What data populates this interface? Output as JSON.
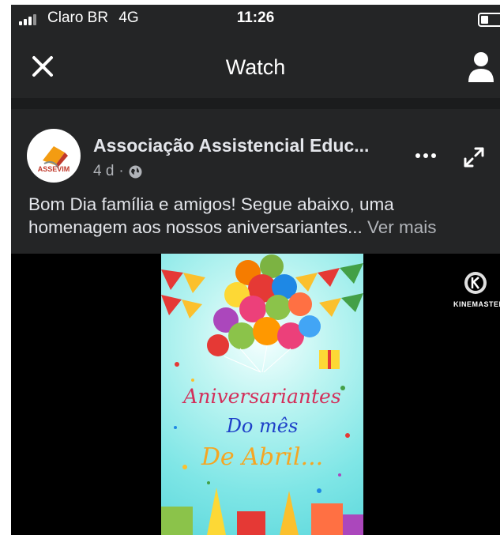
{
  "status_bar": {
    "carrier": "Claro BR",
    "network": "4G",
    "time": "11:26"
  },
  "nav": {
    "title": "Watch"
  },
  "post": {
    "page_name": "Associação Assistencial Educ...",
    "time_ago": "4 d",
    "separator": "·",
    "avatar_label": "ASSEVIM",
    "caption": "Bom Dia família e amigos! Segue abaixo, uma homenagem aos nossos aniversariantes...",
    "see_more": "Ver mais"
  },
  "video": {
    "watermark": "KINEMASTER",
    "card_lines": [
      "Aniversariantes",
      "Do mês",
      "De Abril..."
    ]
  },
  "colors": {
    "background": "#242526",
    "text": "#e4e6eb",
    "secondary_text": "#b0b3b8",
    "video_bg": "#000000"
  }
}
